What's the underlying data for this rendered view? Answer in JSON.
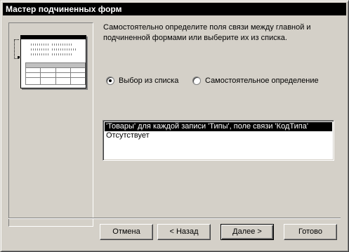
{
  "window": {
    "title": "Мастер подчиненных форм"
  },
  "description": "Самостоятельно определите поля связи между главной и подчиненной формами или выберите их из списка.",
  "options": {
    "from_list": "Выбор из списка",
    "manual": "Самостоятельное определение",
    "selected": "from_list"
  },
  "list": {
    "items": [
      "'Товары' для каждой записи 'Типы', поле связи 'КодТипа'",
      "Отсутствует"
    ],
    "selected_index": 0
  },
  "buttons": {
    "cancel": "Отмена",
    "back": "< Назад",
    "next": "Далее >",
    "finish": "Готово"
  }
}
